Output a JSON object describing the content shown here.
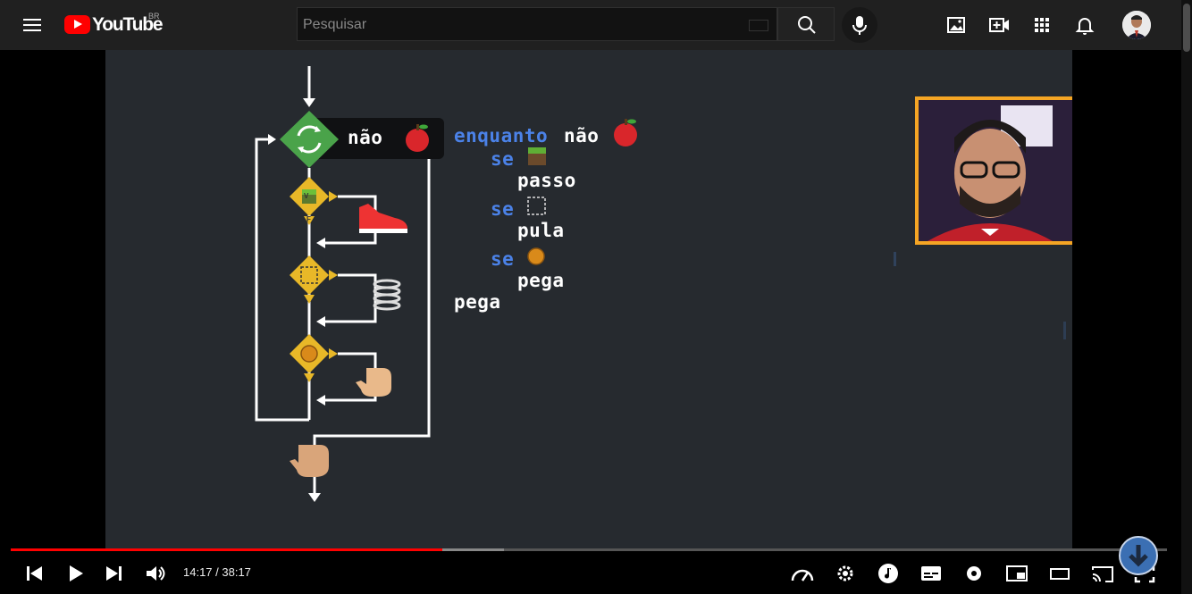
{
  "header": {
    "logo_text": "YouTube",
    "country_code": "BR",
    "search_placeholder": "Pesquisar",
    "icons": [
      "menu-icon",
      "keyboard-icon",
      "search-icon",
      "mic-icon",
      "create-image-icon",
      "create-video-icon",
      "apps-icon",
      "bell-icon",
      "avatar"
    ]
  },
  "video": {
    "flowchart_badge_label": "não",
    "true_branch_label": "V",
    "false_branch_label": "F",
    "code": {
      "line1_keyword": "enquanto",
      "line1_text": "não",
      "line2_keyword": "se",
      "line3_text": "passo",
      "line4_keyword": "se",
      "line5_text": "pula",
      "line6_keyword": "se",
      "line7_text": "pega",
      "line8_text": "pega"
    },
    "colors": {
      "keyword": "#4b82e8",
      "loop_diamond": "#4aa34a",
      "condition_diamond": "#e8b828",
      "webcam_border": "#f5a524"
    }
  },
  "player": {
    "time_display": "14:17 / 38:17",
    "progress_fraction": 0.3734,
    "buffer_fraction": 0.4267,
    "colors": {
      "played": "#ff0000",
      "buffered": "#888888"
    },
    "icons": [
      "previous-icon",
      "play-icon",
      "next-icon",
      "volume-icon",
      "playback-speed-icon",
      "settings-gear-icon",
      "music-icon",
      "subtitles-icon",
      "settings-icon",
      "miniplayer-icon",
      "theater-icon",
      "cast-icon",
      "fullscreen-icon",
      "download-arrow-icon"
    ]
  }
}
